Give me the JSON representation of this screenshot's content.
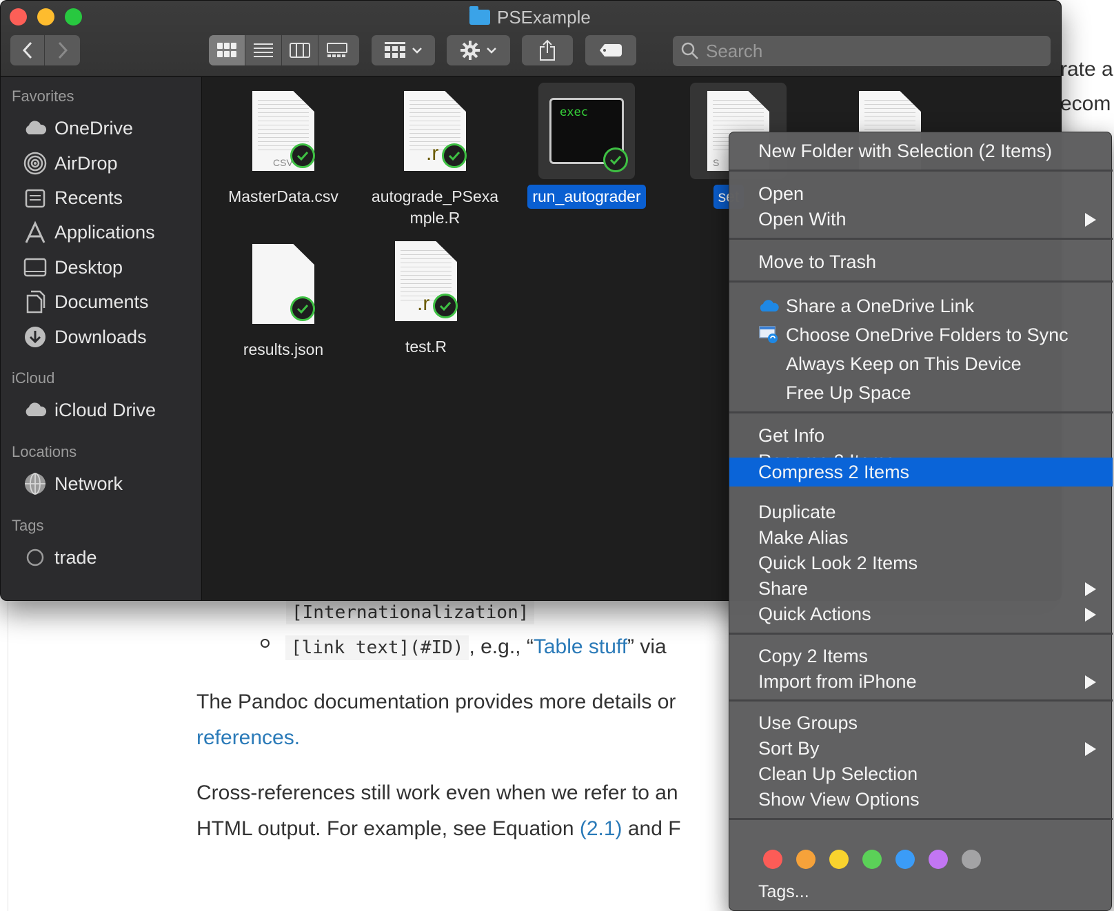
{
  "window": {
    "title": "PSExample"
  },
  "toolbar": {
    "search_placeholder": "Search",
    "icons": [
      "back-icon",
      "forward-icon",
      "icon-view-icon",
      "list-view-icon",
      "column-view-icon",
      "gallery-view-icon",
      "group-icon",
      "gear-icon",
      "share-icon",
      "tag-icon",
      "search-icon"
    ]
  },
  "sidebar": {
    "favorites_heading": "Favorites",
    "favorites": [
      {
        "label": "OneDrive",
        "icon": "cloud-icon"
      },
      {
        "label": "AirDrop",
        "icon": "airdrop-icon"
      },
      {
        "label": "Recents",
        "icon": "recents-icon"
      },
      {
        "label": "Applications",
        "icon": "applications-icon"
      },
      {
        "label": "Desktop",
        "icon": "desktop-icon"
      },
      {
        "label": "Documents",
        "icon": "documents-icon"
      },
      {
        "label": "Downloads",
        "icon": "downloads-icon"
      }
    ],
    "icloud_heading": "iCloud",
    "icloud": [
      {
        "label": "iCloud Drive",
        "icon": "cloud-icon"
      }
    ],
    "locations_heading": "Locations",
    "locations": [
      {
        "label": "Network",
        "icon": "globe-icon"
      }
    ],
    "tags_heading": "Tags",
    "tags": [
      {
        "label": "trade",
        "icon": "tag-circle-icon"
      }
    ]
  },
  "files": [
    {
      "name": "MasterData.csv",
      "ext": "CSV",
      "selected": false
    },
    {
      "name_line1": "autograde_PSexa",
      "name_line2": "mple.R",
      "ext": ".r",
      "selected": false
    },
    {
      "name": "run_autograder",
      "icon_text": "exec",
      "selected": true
    },
    {
      "name": "set",
      "ext": "S",
      "selected": true
    },
    {
      "name": "results.json",
      "selected": false
    },
    {
      "name": "test.R",
      "ext": ".r",
      "selected": false
    }
  ],
  "context_menu": {
    "items": [
      {
        "label": "New Folder with Selection (2 Items)"
      },
      {
        "label": "Open"
      },
      {
        "label": "Open With",
        "submenu": true
      },
      {
        "label": "Move to Trash"
      },
      {
        "label": "Share a OneDrive Link",
        "icon": "onedrive-cloud-icon"
      },
      {
        "label": "Choose OneDrive Folders to Sync",
        "icon": "onedrive-sync-icon"
      },
      {
        "label": "Always Keep on This Device"
      },
      {
        "label": "Free Up Space"
      },
      {
        "label": "Get Info"
      },
      {
        "label": "Rename 2 Items..."
      },
      {
        "label": "Compress 2 Items",
        "highlighted": true
      },
      {
        "label": "Duplicate"
      },
      {
        "label": "Make Alias"
      },
      {
        "label": "Quick Look 2 Items"
      },
      {
        "label": "Share",
        "submenu": true
      },
      {
        "label": "Quick Actions",
        "submenu": true
      },
      {
        "label": "Copy 2 Items"
      },
      {
        "label": "Import from iPhone",
        "submenu": true
      },
      {
        "label": "Use Groups"
      },
      {
        "label": "Sort By",
        "submenu": true
      },
      {
        "label": "Clean Up Selection"
      },
      {
        "label": "Show View Options"
      },
      {
        "label": "Tags..."
      }
    ],
    "tag_colors": [
      "#fc5c57",
      "#f6a23a",
      "#f9d32e",
      "#5bd158",
      "#3b9cf7",
      "#c276f3",
      "#a3a3a5"
    ],
    "highlight_color": "#0a64d8"
  },
  "background_document": {
    "top_fragment_1": "rate a",
    "top_fragment_2": "ecom",
    "code_line": "[Internationalization]",
    "list_code": "[link text](#ID)",
    "list_text_1": ", e.g., “",
    "list_link": "Table stuff",
    "list_text_2": "” via",
    "para1_text": "The Pandoc documentation provides more details or",
    "para1_link": "references.",
    "para2_line1": "Cross-references still work even when we refer to an",
    "para2_line2_a": "HTML output. For example, see Equation ",
    "para2_line2_link": "(2.1)",
    "para2_line2_b": " and F"
  }
}
